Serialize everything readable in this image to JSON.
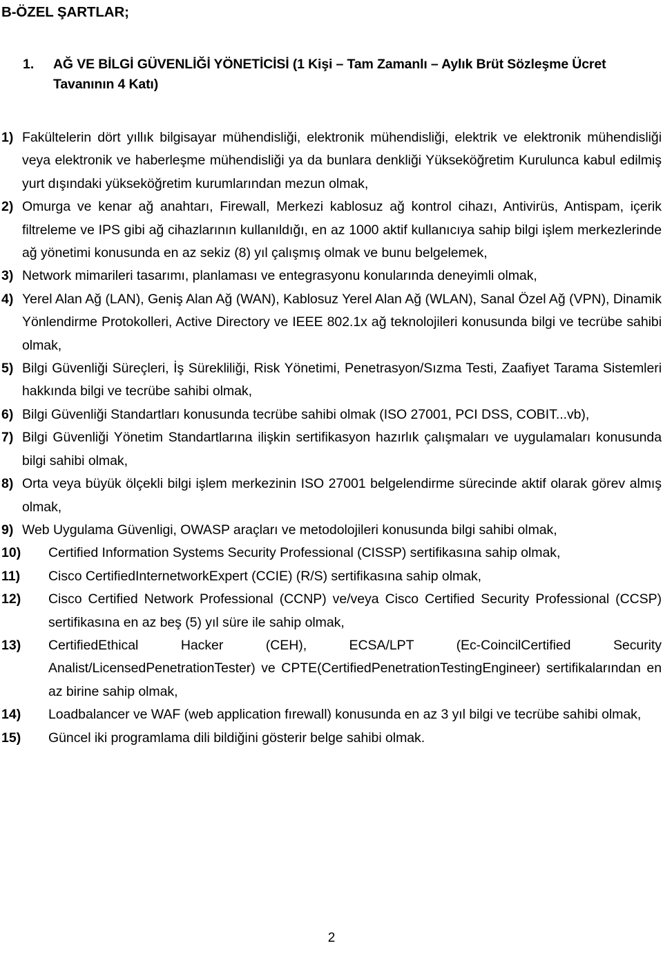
{
  "document": {
    "section_title": "B-ÖZEL ŞARTLAR;",
    "page_number": "2"
  },
  "heading": {
    "number": "1.",
    "text": "AĞ VE BİLGİ GÜVENLİĞİ YÖNETİCİSİ (1 Kişi – Tam Zamanlı – Aylık Brüt Sözleşme Ücret Tavanının 4 Katı)"
  },
  "requirements": [
    {
      "marker": "1)",
      "text": "Fakültelerin dört yıllık bilgisayar mühendisliği, elektronik mühendisliği, elektrik ve elektronik mühendisliği veya elektronik ve haberleşme mühendisliği ya da bunlara denkliği Yükseköğretim Kurulunca kabul edilmiş yurt dışındaki yükseköğretim kurumlarından mezun olmak,"
    },
    {
      "marker": "2)",
      "text": "Omurga ve kenar ağ anahtarı, Firewall, Merkezi kablosuz ağ kontrol cihazı, Antivirüs, Antispam, içerik filtreleme ve IPS gibi ağ cihazlarının kullanıldığı, en az 1000 aktif kullanıcıya sahip bilgi işlem merkezlerinde ağ yönetimi konusunda en az sekiz (8) yıl çalışmış olmak ve bunu belgelemek,"
    },
    {
      "marker": "3)",
      "text": "Network mimarileri tasarımı, planlaması ve entegrasyonu konularında deneyimli olmak,"
    },
    {
      "marker": "4)",
      "text": "Yerel Alan Ağ (LAN), Geniş Alan Ağ (WAN), Kablosuz Yerel Alan Ağ (WLAN), Sanal Özel Ağ (VPN), Dinamik Yönlendirme Protokolleri, Active Directory ve IEEE 802.1x ağ teknolojileri konusunda bilgi ve tecrübe sahibi olmak,"
    },
    {
      "marker": "5)",
      "text": "Bilgi Güvenliği Süreçleri, İş Sürekliliği, Risk Yönetimi, Penetrasyon/Sızma Testi, Zaafiyet Tarama Sistemleri hakkında bilgi ve tecrübe sahibi olmak,"
    },
    {
      "marker": "6)",
      "text": "Bilgi Güvenliği Standartları konusunda tecrübe sahibi olmak (ISO 27001, PCI DSS, COBIT...vb),"
    },
    {
      "marker": "7)",
      "text": "Bilgi Güvenliği Yönetim Standartlarına ilişkin sertifikasyon hazırlık çalışmaları ve uygulamaları konusunda bilgi sahibi olmak,"
    },
    {
      "marker": "8)",
      "text": "Orta veya büyük ölçekli bilgi işlem merkezinin ISO 27001 belgelendirme sürecinde aktif olarak görev almış olmak,"
    },
    {
      "marker": "9)",
      "text": "Web Uygulama Güvenligi, OWASP araçları ve metodolojileri konusunda bilgi sahibi olmak,"
    },
    {
      "marker": "10)",
      "text": "Certified Information Systems Security Professional (CISSP) sertifikasına sahip olmak,"
    },
    {
      "marker": "11)",
      "text": "Cisco CertifiedInternetworkExpert (CCIE) (R/S) sertifikasına sahip olmak,"
    },
    {
      "marker": "12)",
      "text": "Cisco Certified Network Professional (CCNP) ve/veya Cisco Certified Security Professional (CCSP) sertifikasına en az beş (5) yıl süre ile sahip olmak,"
    },
    {
      "marker": "13)",
      "text": "CertifiedEthical Hacker (CEH), ECSA/LPT (Ec-CoincilCertified Security Analist/LicensedPenetrationTester) ve CPTE(CertifiedPenetrationTestingEngineer) sertifikalarından en az birine sahip olmak,"
    },
    {
      "marker": "14)",
      "text": "Loadbalancer ve WAF (web application fırewall) konusunda en az 3 yıl bilgi ve tecrübe sahibi olmak,"
    },
    {
      "marker": "15)",
      "text": "Güncel iki programlama dili bildiğini gösterir belge sahibi olmak."
    }
  ]
}
